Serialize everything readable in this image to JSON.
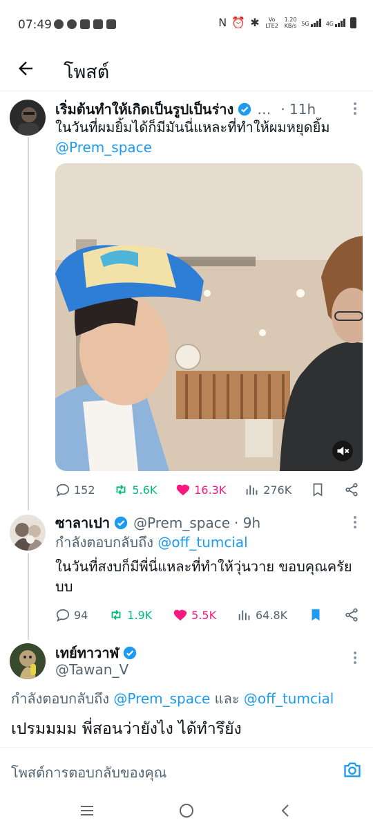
{
  "status_bar": {
    "time": "07:49",
    "volte": "Vo LTE2",
    "speed_value": "1.20",
    "speed_unit": "KB/s",
    "net1": "5G",
    "net2": "4G"
  },
  "header": {
    "title": "โพสต์"
  },
  "tweets": [
    {
      "name": "เริ่มต้นทำให้เกิดเป็นรูปเป็นร่าง",
      "handle": "…",
      "time": "· 11h",
      "text": "ในวันที่ผมยิ้มได้ก็มีมันนี่แหละที่ทำให้ผมหยุดยิ้ม",
      "mention": "@Prem_space",
      "stats": {
        "replies": "152",
        "retweets": "5.6K",
        "likes": "16.3K",
        "views": "276K"
      }
    },
    {
      "name": "ซาลาเปา",
      "handle": "@Prem_space",
      "time": "· 9h",
      "reply_to_label": "กำลังตอบกลับถึง",
      "reply_to": "@off_tumcial",
      "text": "ในวันที่สงบก็มีพี่นี่แหละที่ทำให้วุ่นวาย ขอบคุณครัยบบ",
      "stats": {
        "replies": "94",
        "retweets": "1.9K",
        "likes": "5.5K",
        "views": "64.8K"
      }
    },
    {
      "name": "เทย์ทาวาฬ",
      "handle": "@Tawan_V",
      "reply_to_label": "กำลังตอบกลับถึง",
      "reply_to_1": "@Prem_space",
      "reply_and": "และ",
      "reply_to_2": "@off_tumcial",
      "text": "เปรมมมม พี่สอนว่ายังไง ได้ทำรึยัง"
    }
  ],
  "compose": {
    "placeholder": "โพสต์การตอบกลับของคุณ"
  },
  "colors": {
    "accent": "#1d9bf0",
    "retweet": "#00ba7c",
    "like": "#f91880",
    "muted": "#536471"
  }
}
